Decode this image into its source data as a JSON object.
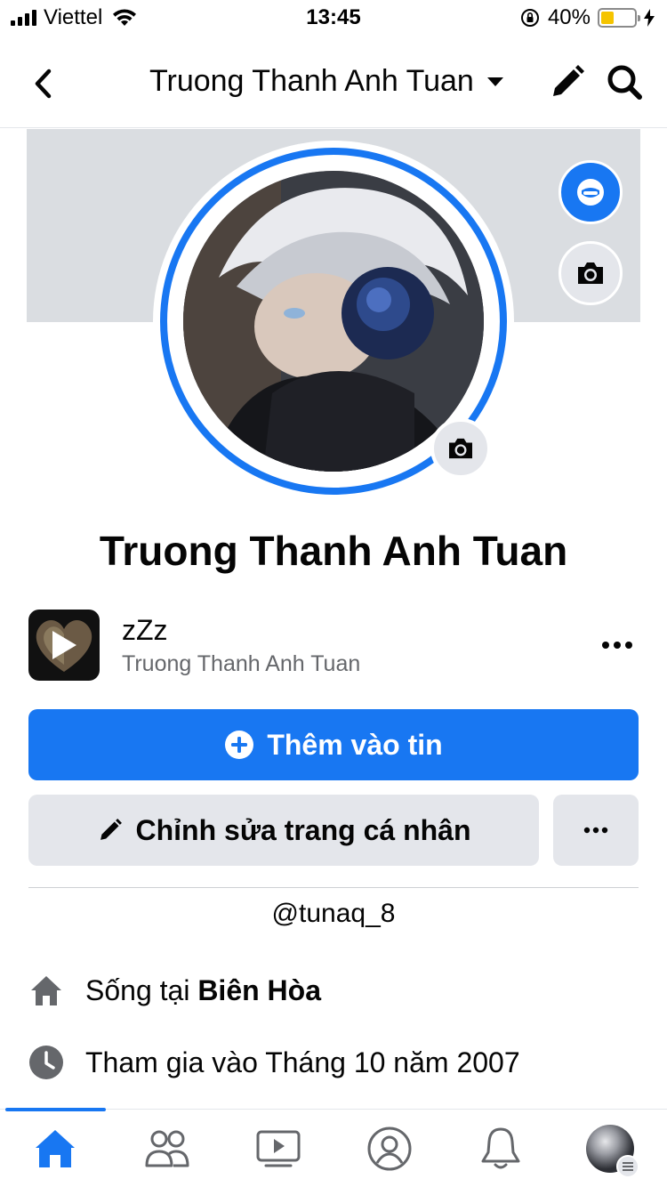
{
  "status_bar": {
    "carrier": "Viettel",
    "time": "13:45",
    "battery_percent_text": "40%",
    "battery_level": 0.4,
    "battery_color": "#f5c400"
  },
  "header": {
    "title": "Truong Thanh Anh Tuan",
    "icons": [
      "back-icon",
      "chevron-down-icon",
      "pencil-icon",
      "search-icon"
    ]
  },
  "profile": {
    "name": "Truong Thanh Anh Tuan",
    "cover_color": "#dadde1",
    "ring_color": "#1877f2"
  },
  "music": {
    "title": "zZz",
    "artist": "Truong Thanh Anh Tuan"
  },
  "actions": {
    "add_story_label": "Thêm vào tin",
    "edit_profile_label": "Chỉnh sửa trang cá nhân"
  },
  "username": "@tunaq_8",
  "intro": {
    "lives_prefix": "Sống tại ",
    "lives_place": "Biên Hòa",
    "joined": "Tham gia vào Tháng 10 năm 2007"
  },
  "tabbar": {
    "items": [
      "home-icon",
      "friends-icon",
      "watch-icon",
      "profile-icon",
      "bell-icon",
      "menu-avatar"
    ],
    "active": "home-icon",
    "accent": "#1877f2"
  }
}
